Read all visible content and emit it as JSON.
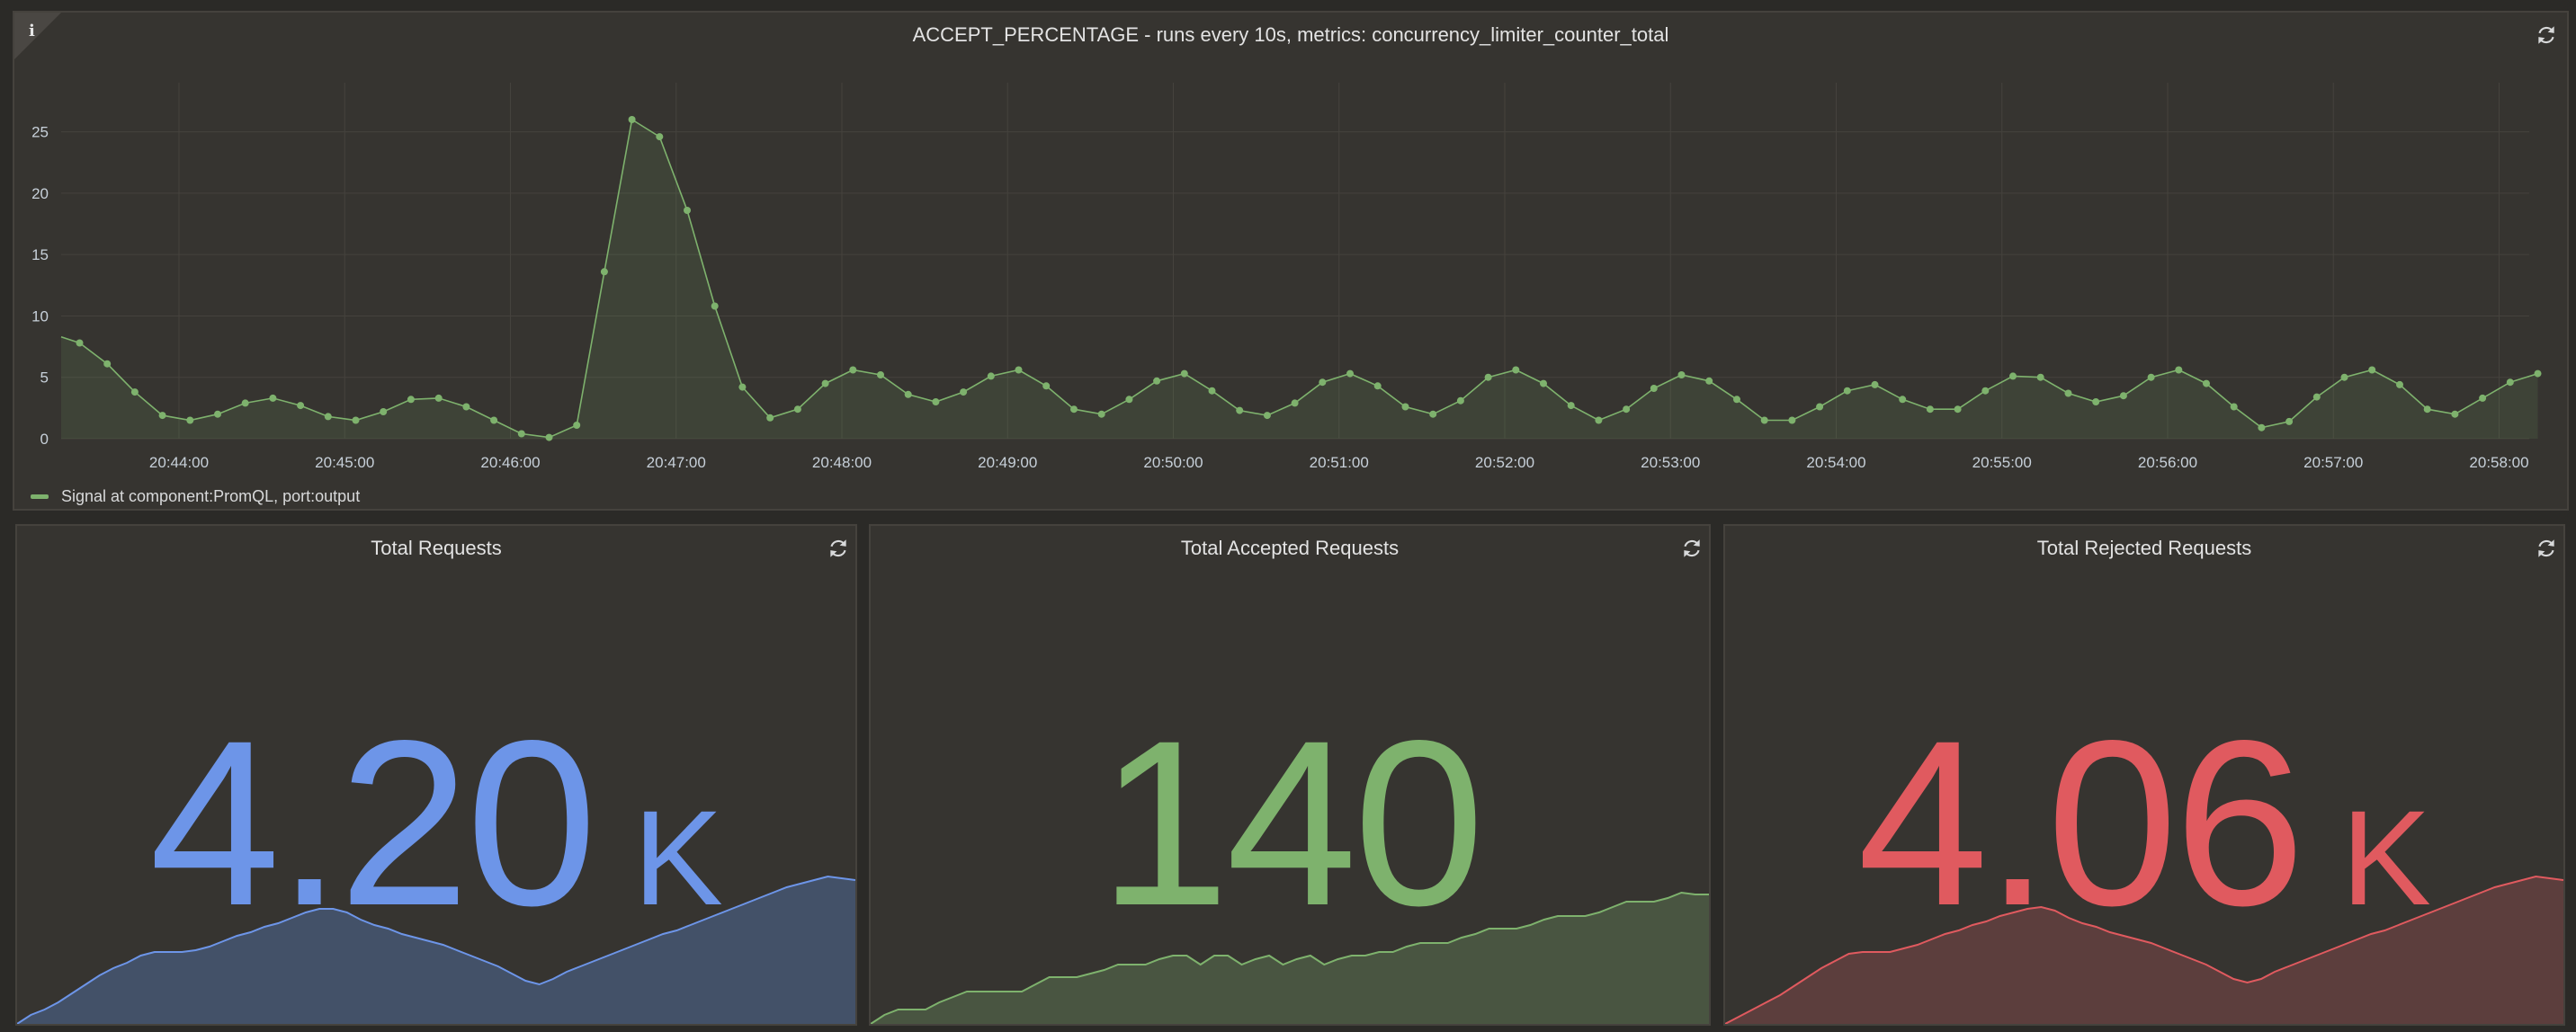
{
  "top_panel": {
    "title": "ACCEPT_PERCENTAGE - runs every 10s, metrics: concurrency_limiter_counter_total",
    "info_icon": "info-icon",
    "refresh_icon": "refresh-icon",
    "legend_label": "Signal at component:PromQL, port:output"
  },
  "chart_data": {
    "type": "line",
    "title": "ACCEPT_PERCENTAGE - runs every 10s, metrics: concurrency_limiter_counter_total",
    "xlabel": "",
    "ylabel": "",
    "ylim": [
      0,
      29
    ],
    "y_ticks": [
      "0",
      "5",
      "10",
      "15",
      "20",
      "25"
    ],
    "x_ticks": [
      "20:44:00",
      "20:45:00",
      "20:46:00",
      "20:47:00",
      "20:48:00",
      "20:49:00",
      "20:50:00",
      "20:51:00",
      "20:52:00",
      "20:53:00",
      "20:54:00",
      "20:55:00",
      "20:56:00",
      "20:57:00",
      "20:58:00"
    ],
    "grid": true,
    "legend_position": "bottom-left",
    "series": [
      {
        "name": "Signal at component:PromQL, port:output",
        "color": "#7eb26d",
        "x": [
          "20:43:24",
          "20:43:34",
          "20:43:44",
          "20:43:54",
          "20:44:04",
          "20:44:14",
          "20:44:24",
          "20:44:34",
          "20:44:44",
          "20:44:54",
          "20:45:04",
          "20:45:14",
          "20:45:24",
          "20:45:34",
          "20:45:44",
          "20:45:54",
          "20:46:04",
          "20:46:14",
          "20:46:24",
          "20:46:34",
          "20:46:44",
          "20:46:54",
          "20:47:04",
          "20:47:14",
          "20:47:24",
          "20:47:34",
          "20:47:44",
          "20:47:54",
          "20:48:04",
          "20:48:14",
          "20:48:24",
          "20:48:34",
          "20:48:44",
          "20:48:54",
          "20:49:04",
          "20:49:14",
          "20:49:24",
          "20:49:34",
          "20:49:44",
          "20:49:54",
          "20:50:04",
          "20:50:14",
          "20:50:24",
          "20:50:34",
          "20:50:44",
          "20:50:54",
          "20:51:04",
          "20:51:14",
          "20:51:24",
          "20:51:34",
          "20:51:44",
          "20:51:54",
          "20:52:04",
          "20:52:14",
          "20:52:24",
          "20:52:34",
          "20:52:44",
          "20:52:54",
          "20:53:04",
          "20:53:14",
          "20:53:24",
          "20:53:34",
          "20:53:44",
          "20:53:54",
          "20:54:04",
          "20:54:14",
          "20:54:24",
          "20:54:34",
          "20:54:44",
          "20:54:54",
          "20:55:04",
          "20:55:14",
          "20:55:24",
          "20:55:34",
          "20:55:44",
          "20:55:54",
          "20:56:04",
          "20:56:14",
          "20:56:24",
          "20:56:34",
          "20:56:44",
          "20:56:54",
          "20:57:04",
          "20:57:14",
          "20:57:24",
          "20:57:34",
          "20:57:44",
          "20:57:54",
          "20:58:04",
          "20:58:14"
        ],
        "values": [
          7.8,
          6.1,
          3.8,
          1.9,
          1.5,
          2.0,
          2.9,
          3.3,
          2.7,
          1.8,
          1.5,
          2.2,
          3.2,
          3.3,
          2.6,
          1.5,
          0.4,
          0.1,
          1.1,
          13.6,
          26.0,
          24.6,
          18.6,
          10.8,
          4.2,
          1.7,
          2.4,
          4.5,
          5.6,
          5.2,
          3.6,
          3.0,
          3.8,
          5.1,
          5.6,
          4.3,
          2.4,
          2.0,
          3.2,
          4.7,
          5.3,
          3.9,
          2.3,
          1.9,
          2.9,
          4.6,
          5.3,
          4.3,
          2.6,
          2.0,
          3.1,
          5.0,
          5.6,
          4.5,
          2.7,
          1.5,
          2.4,
          4.1,
          5.2,
          4.7,
          3.2,
          1.5,
          1.5,
          2.6,
          3.9,
          4.4,
          3.2,
          2.4,
          2.4,
          3.9,
          5.1,
          5.0,
          3.7,
          3.0,
          3.5,
          5.0,
          5.6,
          4.5,
          2.6,
          0.9,
          1.4,
          3.4,
          5.0,
          5.6,
          4.4,
          2.4,
          2.0,
          3.3,
          4.6,
          5.3
        ]
      }
    ]
  },
  "stats": [
    {
      "title": "Total Requests",
      "value": "4.20",
      "unit": "K",
      "color": "#6d95e8",
      "spark_fill": "#435168",
      "spark": [
        0.0,
        0.05,
        0.08,
        0.12,
        0.17,
        0.22,
        0.27,
        0.31,
        0.34,
        0.38,
        0.4,
        0.4,
        0.4,
        0.41,
        0.43,
        0.46,
        0.49,
        0.51,
        0.54,
        0.56,
        0.59,
        0.62,
        0.64,
        0.64,
        0.62,
        0.58,
        0.55,
        0.53,
        0.5,
        0.48,
        0.46,
        0.44,
        0.41,
        0.38,
        0.35,
        0.32,
        0.28,
        0.24,
        0.22,
        0.25,
        0.29,
        0.32,
        0.35,
        0.38,
        0.41,
        0.44,
        0.47,
        0.5,
        0.52,
        0.55,
        0.58,
        0.61,
        0.64,
        0.67,
        0.7,
        0.73,
        0.76,
        0.78,
        0.8,
        0.82,
        0.81,
        0.8
      ]
    },
    {
      "title": "Total Accepted Requests",
      "value": "140",
      "unit": "",
      "color": "#7eb26d",
      "spark_fill": "#495541",
      "spark": [
        0.0,
        0.05,
        0.08,
        0.08,
        0.08,
        0.12,
        0.15,
        0.18,
        0.18,
        0.18,
        0.18,
        0.18,
        0.22,
        0.26,
        0.26,
        0.26,
        0.28,
        0.3,
        0.33,
        0.33,
        0.33,
        0.36,
        0.38,
        0.38,
        0.33,
        0.38,
        0.38,
        0.33,
        0.36,
        0.38,
        0.33,
        0.36,
        0.38,
        0.33,
        0.36,
        0.38,
        0.38,
        0.4,
        0.4,
        0.43,
        0.45,
        0.45,
        0.45,
        0.48,
        0.5,
        0.53,
        0.53,
        0.53,
        0.55,
        0.58,
        0.6,
        0.6,
        0.6,
        0.62,
        0.65,
        0.68,
        0.68,
        0.68,
        0.7,
        0.73,
        0.72,
        0.72
      ]
    },
    {
      "title": "Total Rejected Requests",
      "value": "4.06",
      "unit": "K",
      "color": "#e05a5f",
      "spark_fill": "#5c3e3d",
      "spark": [
        0.0,
        0.04,
        0.08,
        0.12,
        0.16,
        0.21,
        0.26,
        0.31,
        0.35,
        0.39,
        0.4,
        0.4,
        0.4,
        0.42,
        0.44,
        0.47,
        0.5,
        0.52,
        0.55,
        0.57,
        0.6,
        0.62,
        0.64,
        0.65,
        0.63,
        0.59,
        0.56,
        0.54,
        0.51,
        0.49,
        0.47,
        0.45,
        0.42,
        0.39,
        0.36,
        0.33,
        0.29,
        0.25,
        0.23,
        0.25,
        0.29,
        0.32,
        0.35,
        0.38,
        0.41,
        0.44,
        0.47,
        0.5,
        0.52,
        0.55,
        0.58,
        0.61,
        0.64,
        0.67,
        0.7,
        0.73,
        0.76,
        0.78,
        0.8,
        0.82,
        0.81,
        0.8
      ]
    }
  ]
}
